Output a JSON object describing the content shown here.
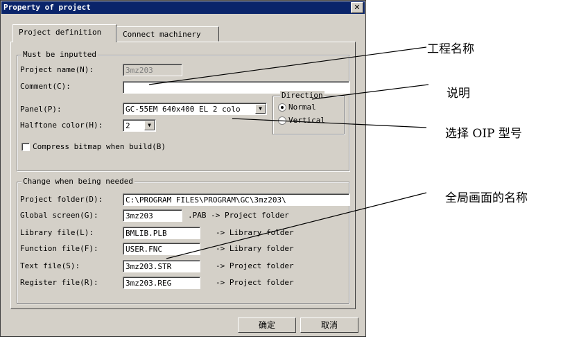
{
  "dialog": {
    "title": "Property of project",
    "close_glyph": "✕",
    "tabs": [
      {
        "label": "Project definition"
      },
      {
        "label": "Connect machinery"
      }
    ]
  },
  "must": {
    "legend": "Must be inputted",
    "project_name_label": "Project name(N):",
    "project_name_value": "3mz203",
    "comment_label": "Comment(C):",
    "comment_value": "",
    "panel_label": "Panel(P):",
    "panel_value": "GC-55EM 640x400 EL  2 colo",
    "halftone_label": "Halftone color(H):",
    "halftone_value": "2",
    "direction_legend": "Direction",
    "direction_normal": "Normal",
    "direction_vertical": "Vertical",
    "direction_selected": "Normal",
    "compress_label": "Compress bitmap when build(B)",
    "compress_checked": false
  },
  "change": {
    "legend": "Change when being needed",
    "project_folder_label": "Project folder(D):",
    "project_folder_value": "C:\\PROGRAM FILES\\PROGRAM\\GC\\3mz203\\",
    "global_label": "Global screen(G):",
    "global_value": "3mz203",
    "global_suffix": ".PAB -> Project folder",
    "library_label": "Library file(L):",
    "library_value": "BMLIB.PLB",
    "library_suffix": "-> Library folder",
    "function_label": "Function file(F):",
    "function_value": "USER.FNC",
    "function_suffix": "-> Library folder",
    "text_label": "Text file(S):",
    "text_value": "3mz203.STR",
    "text_suffix": "-> Project folder",
    "register_label": "Register file(R):",
    "register_value": "3mz203.REG",
    "register_suffix": "-> Project folder"
  },
  "buttons": {
    "ok": "确定",
    "cancel": "取消"
  },
  "annotations": {
    "project_name": "工程名称",
    "comment": "说明",
    "oip_model": "选择 OIP 型号",
    "global_screen": "全局画面的名称"
  }
}
